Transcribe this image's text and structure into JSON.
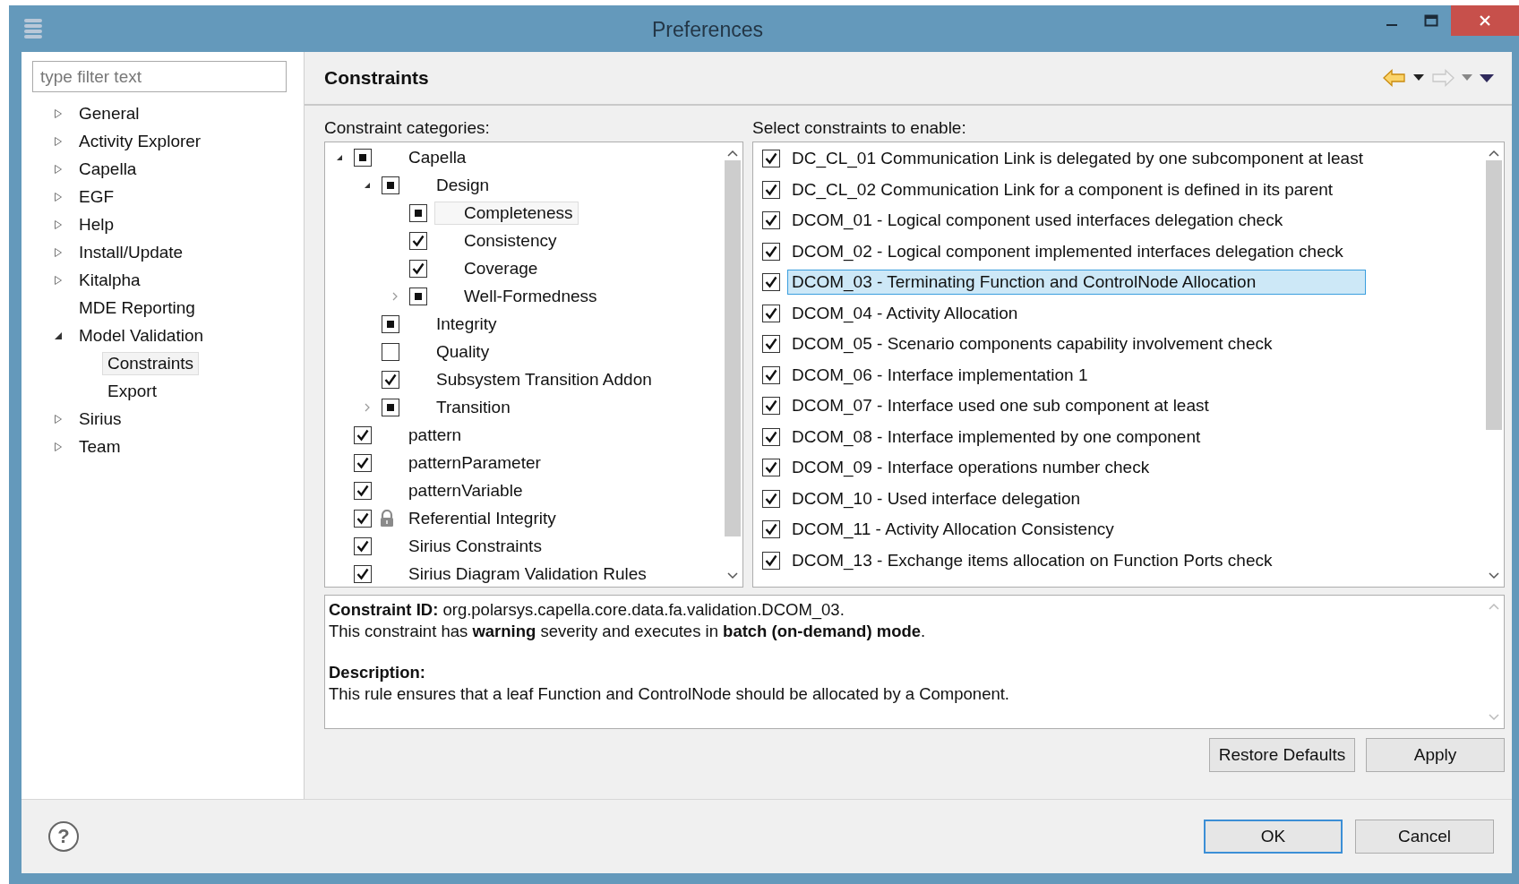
{
  "window": {
    "title": "Preferences"
  },
  "filter": {
    "placeholder": "type filter text"
  },
  "nav": [
    {
      "label": "General",
      "expanded": false,
      "selected": false
    },
    {
      "label": "Activity Explorer",
      "expanded": false,
      "selected": false
    },
    {
      "label": "Capella",
      "expanded": false,
      "selected": false
    },
    {
      "label": "EGF",
      "expanded": false,
      "selected": false
    },
    {
      "label": "Help",
      "expanded": false,
      "selected": false
    },
    {
      "label": "Install/Update",
      "expanded": false,
      "selected": false
    },
    {
      "label": "Kitalpha",
      "expanded": false,
      "selected": false
    },
    {
      "label": "MDE Reporting",
      "selected": false
    },
    {
      "label": "Model Validation",
      "expanded": true,
      "selected": false,
      "children": [
        {
          "label": "Constraints",
          "selected": true
        },
        {
          "label": "Export",
          "selected": false
        }
      ]
    },
    {
      "label": "Sirius",
      "expanded": false,
      "selected": false
    },
    {
      "label": "Team",
      "expanded": false,
      "selected": false
    }
  ],
  "page": {
    "title": "Constraints"
  },
  "history": [
    {
      "kind": "back",
      "disabled": false
    },
    {
      "kind": "forward",
      "disabled": true
    }
  ],
  "categories_label": "Constraint categories:",
  "categories": [
    {
      "label": "Capella",
      "checked": true,
      "grayed": true,
      "expanded": true,
      "selected": false,
      "children": [
        {
          "label": "Design",
          "checked": true,
          "grayed": true,
          "expanded": true,
          "selected": false,
          "children": [
            {
              "label": "Completeness",
              "checked": true,
              "grayed": true,
              "selected": true
            },
            {
              "label": "Consistency",
              "checked": true,
              "grayed": false,
              "selected": false
            },
            {
              "label": "Coverage",
              "checked": true,
              "grayed": false,
              "selected": false
            },
            {
              "label": "Well-Formedness",
              "checked": true,
              "grayed": true,
              "expanded": false,
              "selected": false
            }
          ]
        },
        {
          "label": "Integrity",
          "checked": true,
          "grayed": true,
          "selected": false
        },
        {
          "label": "Quality",
          "checked": false,
          "grayed": false,
          "selected": false
        },
        {
          "label": "Subsystem Transition Addon",
          "checked": true,
          "grayed": false,
          "selected": false
        },
        {
          "label": "Transition",
          "checked": true,
          "grayed": true,
          "expanded": false,
          "selected": false
        }
      ]
    },
    {
      "label": "pattern",
      "checked": true,
      "grayed": false,
      "selected": false
    },
    {
      "label": "patternParameter",
      "checked": true,
      "grayed": false,
      "selected": false
    },
    {
      "label": "patternVariable",
      "checked": true,
      "grayed": false,
      "selected": false
    },
    {
      "label": "Referential Integrity",
      "checked": true,
      "grayed": false,
      "locked": true,
      "selected": false
    },
    {
      "label": "Sirius Constraints",
      "checked": true,
      "grayed": false,
      "selected": false
    },
    {
      "label": "Sirius Diagram Validation Rules",
      "checked": true,
      "grayed": false,
      "selected": false
    }
  ],
  "constraints_label": "Select constraints to enable:",
  "constraints": [
    {
      "label": "DC_CL_01  Communication Link is delegated by one subcomponent at least",
      "checked": true,
      "selected": false
    },
    {
      "label": "DC_CL_02 Communication Link for a component is defined in its parent",
      "checked": true,
      "selected": false
    },
    {
      "label": "DCOM_01 - Logical component used interfaces delegation check",
      "checked": true,
      "selected": false
    },
    {
      "label": "DCOM_02 - Logical component implemented interfaces delegation check",
      "checked": true,
      "selected": false
    },
    {
      "label": "DCOM_03 - Terminating Function and ControlNode Allocation",
      "checked": true,
      "selected": true
    },
    {
      "label": "DCOM_04 - Activity Allocation",
      "checked": true,
      "selected": false
    },
    {
      "label": "DCOM_05 - Scenario components capability involvement check",
      "checked": true,
      "selected": false
    },
    {
      "label": "DCOM_06 - Interface implementation 1",
      "checked": true,
      "selected": false
    },
    {
      "label": "DCOM_07 - Interface used one sub component at least",
      "checked": true,
      "selected": false
    },
    {
      "label": "DCOM_08 - Interface implemented by one component",
      "checked": true,
      "selected": false
    },
    {
      "label": "DCOM_09 - Interface operations number check",
      "checked": true,
      "selected": false
    },
    {
      "label": "DCOM_10 - Used interface delegation",
      "checked": true,
      "selected": false
    },
    {
      "label": "DCOM_11 - Activity Allocation Consistency",
      "checked": true,
      "selected": false
    },
    {
      "label": "DCOM_13 - Exchange items allocation on Function Ports check",
      "checked": true,
      "selected": false
    }
  ],
  "details": [
    {
      "kind": "text",
      "text": "**Constraint ID:** org.polarsys.capella.core.data.fa.validation.DCOM_03."
    },
    {
      "kind": "text",
      "text": "This constraint has **warning** severity and executes in **batch (on-demand) mode**."
    },
    {
      "kind": "heading",
      "text": "Description:"
    },
    {
      "kind": "text",
      "text": "This rule ensures that a leaf Function and ControlNode should be allocated by a Component."
    }
  ],
  "buttons": [
    {
      "label": "Restore Defaults"
    },
    {
      "label": "Apply"
    }
  ],
  "dialog_buttons": [
    {
      "label": "OK",
      "default": true
    },
    {
      "label": "Cancel",
      "default": false
    }
  ],
  "help": {
    "glyph": "?"
  }
}
